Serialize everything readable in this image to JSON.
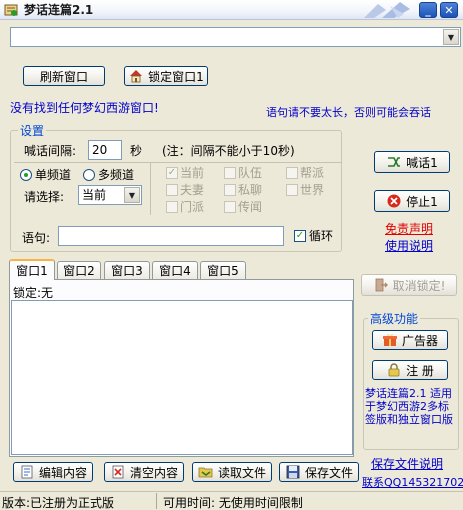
{
  "window": {
    "title": "梦话连篇2.1",
    "minimize": "_",
    "close": "✕"
  },
  "window_combo": {
    "value": ""
  },
  "toolbar": {
    "refresh_label": "刷新窗口",
    "lock_label": "锁定窗口1"
  },
  "messages": {
    "status": "没有找到任何梦幻西游窗口!",
    "hint": "语句请不要太长，否则可能会吞话"
  },
  "settings": {
    "legend": "设置",
    "interval_label": "喊话间隔:",
    "interval_value": "20",
    "interval_unit": "秒",
    "interval_note": "(注：间隔不能小于10秒)",
    "single_channel": "单频道",
    "multi_channel": "多频道",
    "choose_label": "请选择:",
    "channel_value": "当前",
    "channels": [
      "当前",
      "队伍",
      "帮派",
      "夫妻",
      "私聊",
      "世界",
      "门派",
      "传闻"
    ],
    "phrase_label": "语句:",
    "phrase_value": "",
    "loop_label": "循环",
    "loop_checked": true
  },
  "actions": {
    "shout_label": "喊话1",
    "stop_label": "停止1",
    "disclaimer": "免责声明",
    "manual": "使用说明",
    "unlock_label": "取消锁定!"
  },
  "tabs": [
    "窗口1",
    "窗口2",
    "窗口3",
    "窗口4",
    "窗口5"
  ],
  "panel": {
    "lock_status": "锁定:无"
  },
  "advanced": {
    "legend": "高级功能",
    "ads_label": "广告器",
    "register_label": "注  册",
    "about": "梦话连篇2.1 适用于梦幻西游2多标签版和独立窗口版"
  },
  "bottom": {
    "edit_label": "编辑内容",
    "clear_label": "清空内容",
    "read_label": "读取文件",
    "save_label": "保存文件",
    "save_note": "保存文件说明",
    "contact": "联系QQ1453217020"
  },
  "statusbar": {
    "version": "版本:已注册为正式版",
    "time": "可用时间: 无使用时间限制"
  },
  "colors": {
    "accent_blue": "#0000cc",
    "link_red": "#e00000",
    "tab_highlight": "#f9b33f"
  }
}
